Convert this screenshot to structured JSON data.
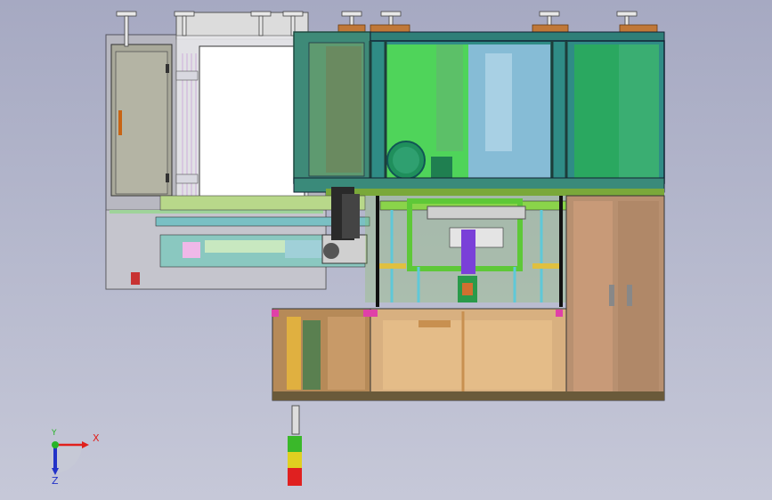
{
  "viewport": {
    "background_top": "#a6a9c2",
    "background_bottom": "#c6c8d8"
  },
  "triad": {
    "x_label": "X",
    "y_label": "Y",
    "z_label": "Z",
    "x_color": "#e0201c",
    "y_color": "#28b428",
    "z_color": "#2232c8"
  },
  "signal_tower": {
    "lights": [
      "green",
      "yellow",
      "red"
    ]
  }
}
